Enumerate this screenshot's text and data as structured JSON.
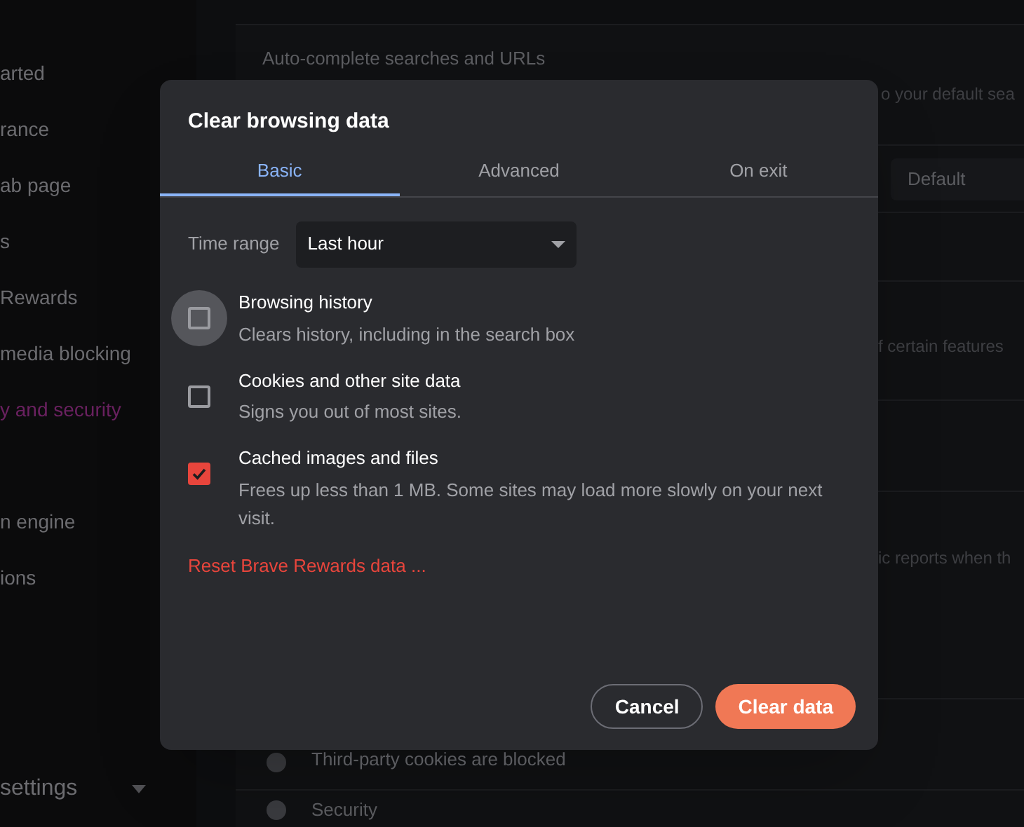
{
  "sidebar": {
    "groups": [
      [
        {
          "label": "arted",
          "selected": false
        },
        {
          "label": "rance",
          "selected": false
        },
        {
          "label": "ab page",
          "selected": false
        },
        {
          "label": "s",
          "selected": false
        },
        {
          "label": "Rewards",
          "selected": false
        },
        {
          "label": "media blocking",
          "selected": false
        },
        {
          "label": "y and security",
          "selected": true
        }
      ],
      [
        {
          "label": "n engine",
          "selected": false
        },
        {
          "label": "ions",
          "selected": false
        }
      ]
    ],
    "footer": {
      "label": "settings",
      "expanded": false
    }
  },
  "content": {
    "autocomplete": {
      "title": "Auto-complete searches and URLs",
      "description": "o your default sea"
    },
    "select": {
      "value": "Default"
    },
    "fragments": [
      "f certain features",
      "ic reports when th"
    ],
    "cookies": {
      "description": "Third-party cookies are blocked"
    },
    "security": {
      "title": "Security"
    }
  },
  "dialog": {
    "title": "Clear browsing data",
    "tabs": [
      {
        "label": "Basic",
        "selected": true
      },
      {
        "label": "Advanced",
        "selected": false
      },
      {
        "label": "On exit",
        "selected": false
      }
    ],
    "time_range": {
      "label": "Time range",
      "value": "Last hour"
    },
    "options": [
      {
        "title": "Browsing history",
        "description": "Clears history, including in the search box",
        "checked": false,
        "focused": true
      },
      {
        "title": "Cookies and other site data",
        "description": "Signs you out of most sites.",
        "checked": false,
        "focused": false
      },
      {
        "title": "Cached images and files",
        "description": "Frees up less than 1 MB. Some sites may load more slowly on your next visit.",
        "checked": true,
        "focused": false
      }
    ],
    "reset_link": "Reset Brave Rewards data ...",
    "buttons": [
      {
        "label": "Cancel",
        "kind": "secondary"
      },
      {
        "label": "Clear data",
        "kind": "primary"
      }
    ]
  }
}
